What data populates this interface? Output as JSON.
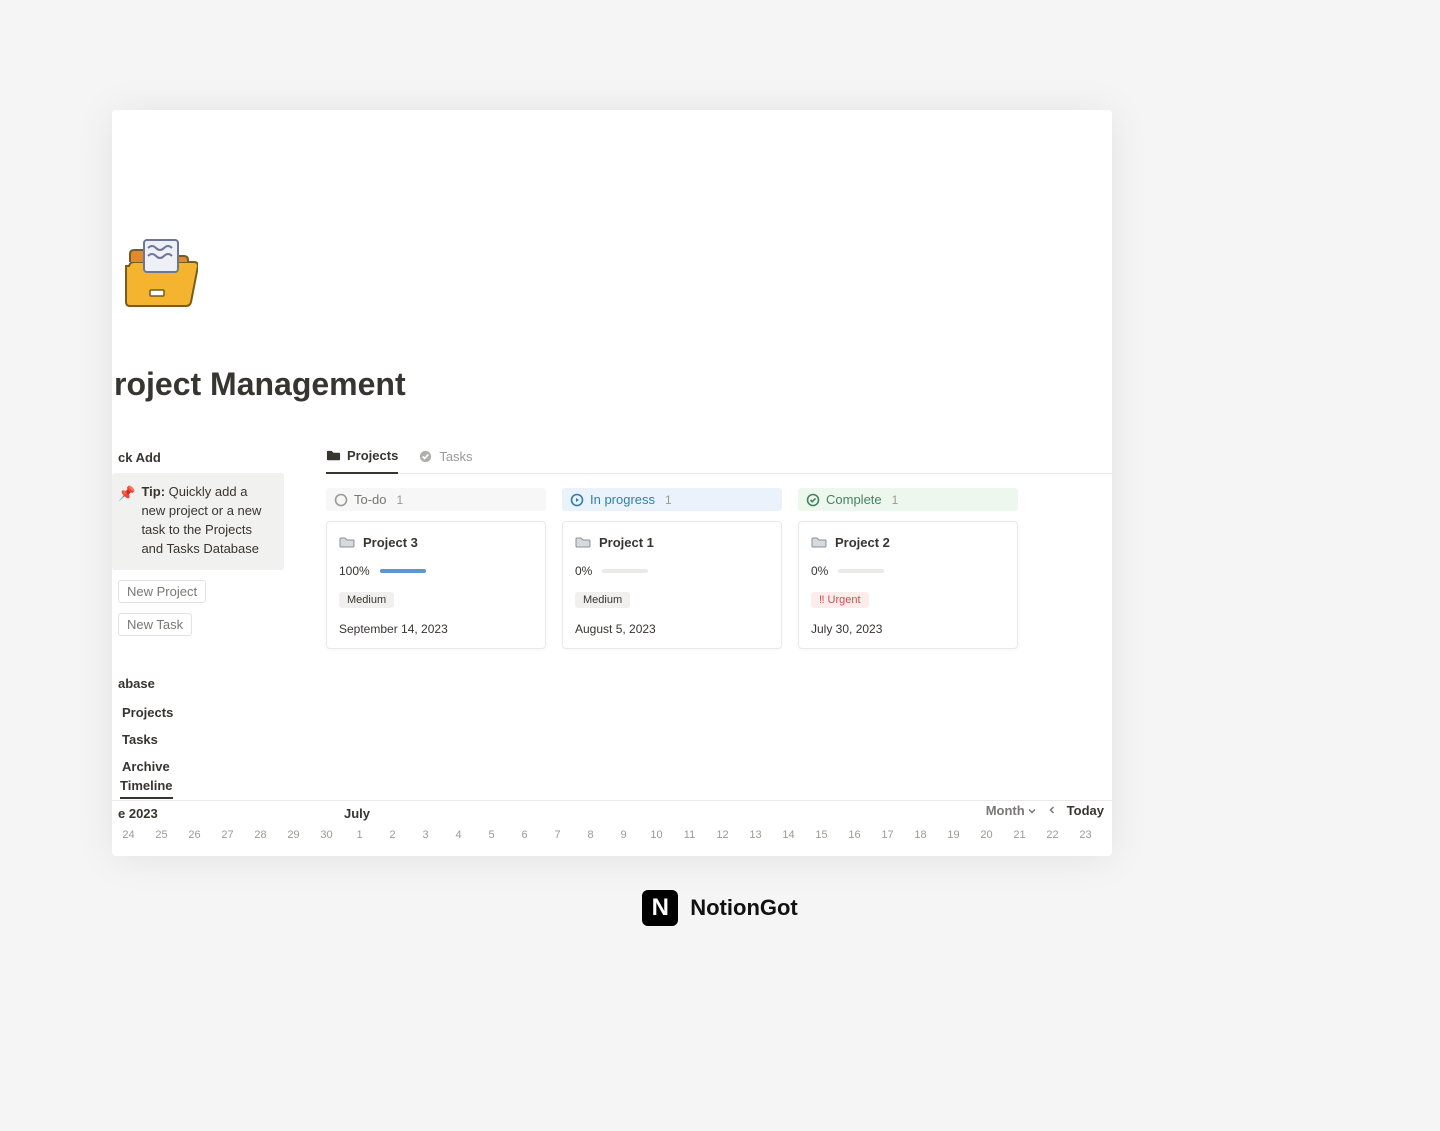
{
  "page": {
    "title": "roject Management",
    "quick_add_label": "ck Add",
    "tip_strong": "Tip:",
    "tip_body": "Quickly add a new project or a new task to the Projects and Tasks Database",
    "new_project": "New Project",
    "new_task": "New Task",
    "db_heading": "abase",
    "db_links": {
      "projects": "Projects",
      "tasks": "Tasks",
      "archive": "Archive"
    }
  },
  "tabs": {
    "projects": "Projects",
    "tasks": "Tasks"
  },
  "columns": {
    "todo": {
      "label": "To-do",
      "count": "1"
    },
    "inprog": {
      "label": "In progress",
      "count": "1"
    },
    "done": {
      "label": "Complete",
      "count": "1"
    }
  },
  "cards": {
    "c1": {
      "title": "Project 3",
      "pct": "100%",
      "fill": "100%",
      "tag": "Medium",
      "tag_urgent": false,
      "date": "September 14, 2023"
    },
    "c2": {
      "title": "Project 1",
      "pct": "0%",
      "fill": "0%",
      "tag": "Medium",
      "tag_urgent": false,
      "date": "August 5, 2023"
    },
    "c3": {
      "title": "Project 2",
      "pct": "0%",
      "fill": "0%",
      "tag": "‼ Urgent",
      "tag_urgent": true,
      "date": "July 30, 2023"
    }
  },
  "timeline": {
    "tab": "Timeline",
    "month1": "e 2023",
    "month2": "July",
    "scale": "Month",
    "today": "Today",
    "days": [
      "24",
      "25",
      "26",
      "27",
      "28",
      "29",
      "30",
      "1",
      "2",
      "3",
      "4",
      "5",
      "6",
      "7",
      "8",
      "9",
      "10",
      "11",
      "12",
      "13",
      "14",
      "15",
      "16",
      "17",
      "18",
      "19",
      "20",
      "21",
      "22",
      "23"
    ]
  },
  "brand": {
    "text": "NotionGot"
  }
}
